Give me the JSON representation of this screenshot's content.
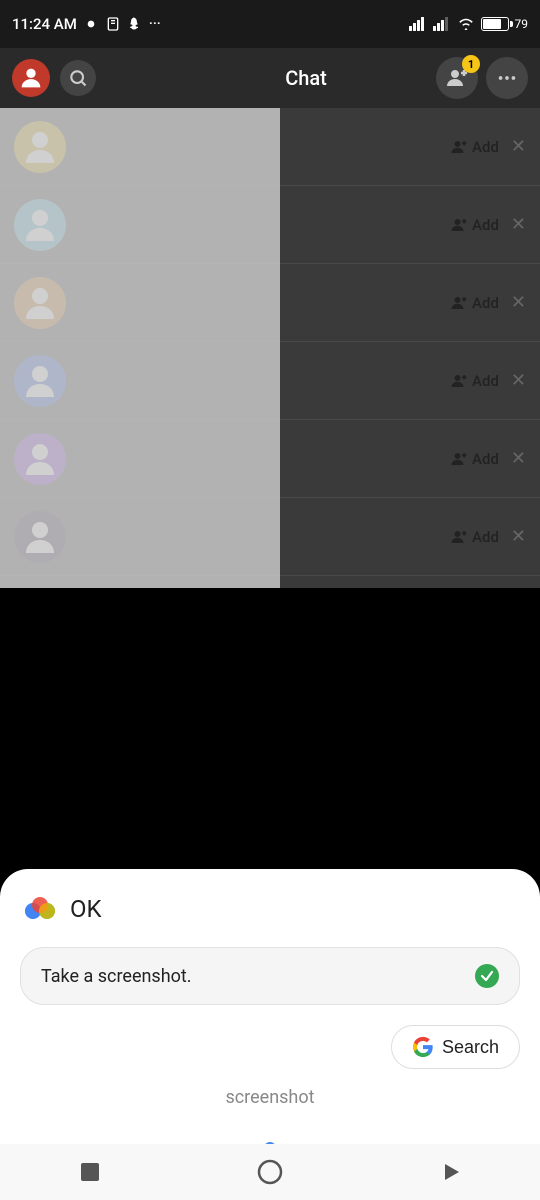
{
  "statusBar": {
    "time": "11:24 AM",
    "battery": "79"
  },
  "topNav": {
    "title": "Chat",
    "badge": "1"
  },
  "chatItems": [
    {
      "color": "#c8a000",
      "addLabel": "Add"
    },
    {
      "color": "#4aabcb",
      "addLabel": "Add"
    },
    {
      "color": "#c07020",
      "addLabel": "Add"
    },
    {
      "color": "#2255cc",
      "addLabel": "Add"
    },
    {
      "color": "#7730cc",
      "addLabel": "Add"
    },
    {
      "color": "#2a1a3a",
      "addLabel": "Add"
    }
  ],
  "assistant": {
    "ok": "OK",
    "inputText": "Take a screenshot.",
    "searchLabel": "Search",
    "wordLabel": "screenshot"
  }
}
